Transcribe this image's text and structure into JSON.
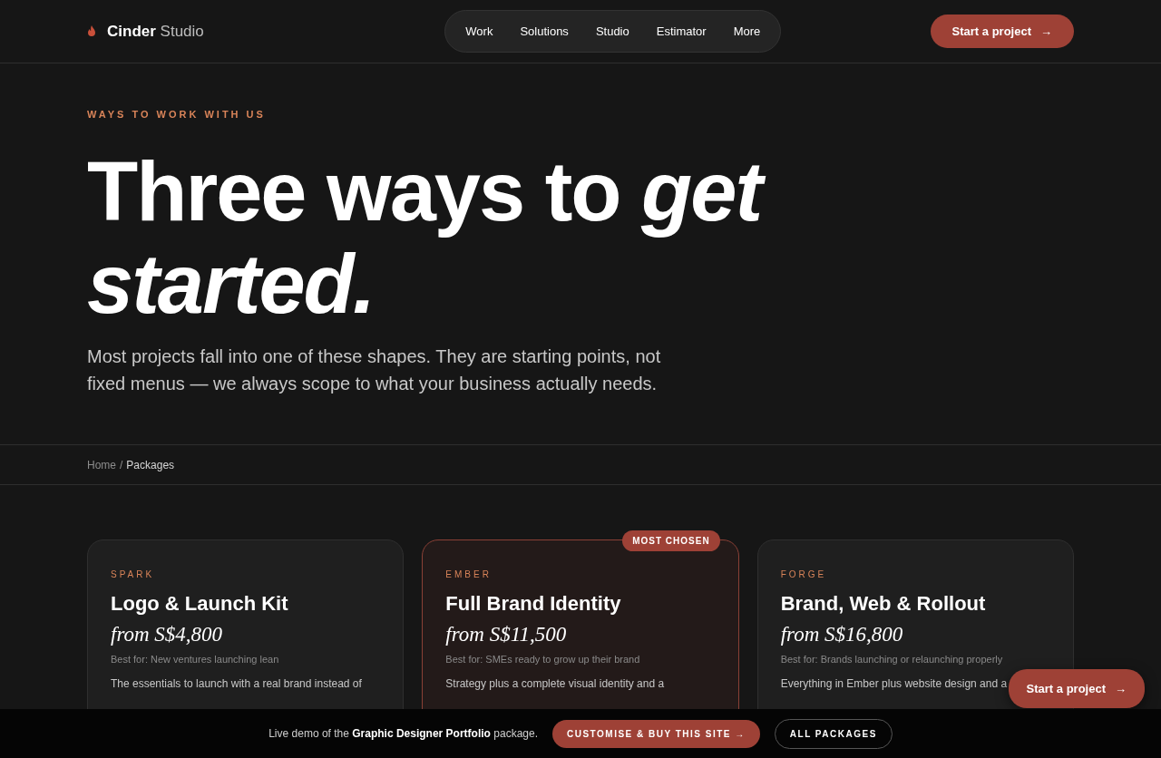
{
  "header": {
    "brand": {
      "name": "Cinder",
      "suffix": "Studio"
    },
    "nav": [
      {
        "label": "Work",
        "selected": false
      },
      {
        "label": "Solutions",
        "selected": false
      },
      {
        "label": "Studio",
        "selected": false
      },
      {
        "label": "Estimator",
        "selected": false
      },
      {
        "label": "More",
        "selected": false
      }
    ],
    "cta": {
      "label": "Start a project",
      "arrow": "→"
    }
  },
  "hero": {
    "eyebrow": "WAYS TO WORK WITH US",
    "title": "Three ways to *get started.*",
    "lead": "Most projects fall into one of these shapes. They are starting points, not fixed menus — we always scope to what your business actually needs."
  },
  "breadcrumb": {
    "items": [
      "Home",
      "Packages"
    ],
    "separator": "/"
  },
  "packages": [
    {
      "tier": "SPARK",
      "name": "Logo & Launch Kit",
      "price": "from S$4,800",
      "best_for": "Best for: New ventures launching lean",
      "description": "The essentials to launch with a real brand instead of",
      "featured": false
    },
    {
      "tier": "EMBER",
      "name": "Full Brand Identity",
      "price": "from S$11,500",
      "best_for": "Best for: SMEs ready to grow up their brand",
      "description": "Strategy plus a complete visual identity and a",
      "featured": true,
      "badge": "MOST CHOSEN"
    },
    {
      "tier": "FORGE",
      "name": "Brand, Web & Rollout",
      "price": "from S$16,800",
      "best_for": "Best for: Brands launching or relaunching properly",
      "description": "Everything in Ember plus website design and a",
      "featured": false
    }
  ],
  "floating_cta": {
    "label": "Start a project",
    "arrow": "→"
  },
  "demo_bar": {
    "text": "Live demo of the **Graphic Designer Portfolio** package.",
    "primary": "CUSTOMISE & BUY THIS SITE →",
    "secondary": "ALL PACKAGES"
  }
}
